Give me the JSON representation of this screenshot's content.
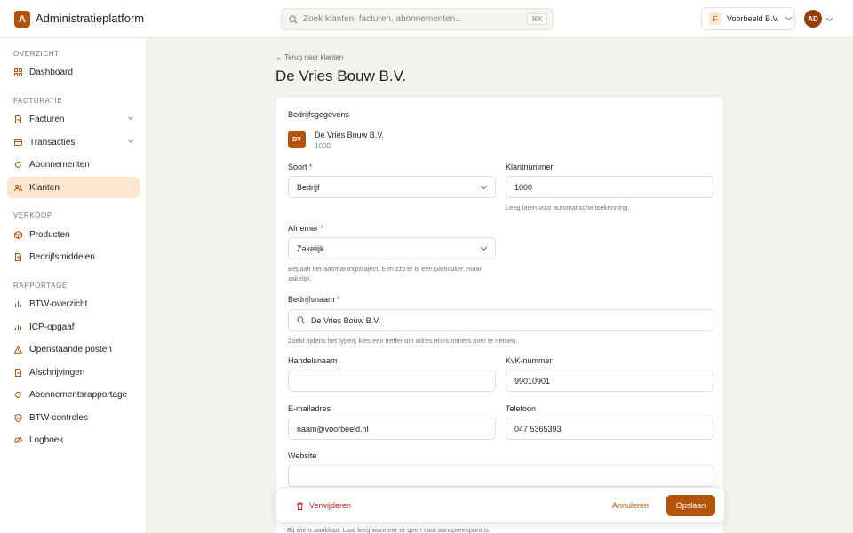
{
  "app": {
    "logo_letter": "A",
    "title": "Administratieplatform"
  },
  "search": {
    "placeholder": "Zoek klanten, facturen, abonnementen...",
    "shortcut": "⌘K"
  },
  "org": {
    "badge": "F",
    "name": "Voorbeeld B.V."
  },
  "user": {
    "initials": "AD"
  },
  "sidebar": {
    "sections": [
      {
        "label": "OVERZICHT",
        "items": [
          {
            "label": "Dashboard",
            "icon": "grid-icon"
          }
        ]
      },
      {
        "label": "FACTURATIE",
        "items": [
          {
            "label": "Facturen",
            "icon": "document-icon",
            "expandable": true
          },
          {
            "label": "Transacties",
            "icon": "card-icon",
            "expandable": true
          },
          {
            "label": "Abonnementen",
            "icon": "refresh-icon"
          },
          {
            "label": "Klanten",
            "icon": "users-icon",
            "active": true
          }
        ]
      },
      {
        "label": "VERKOOP",
        "items": [
          {
            "label": "Producten",
            "icon": "box-icon"
          },
          {
            "label": "Bedrijfsmiddelen",
            "icon": "file-icon"
          }
        ]
      },
      {
        "label": "RAPPORTAGE",
        "items": [
          {
            "label": "BTW-overzicht",
            "icon": "bar-chart-icon"
          },
          {
            "label": "ICP-opgaaf",
            "icon": "bar-chart-icon"
          },
          {
            "label": "Openstaande posten",
            "icon": "warning-icon"
          },
          {
            "label": "Afschrijvingen",
            "icon": "document-icon"
          },
          {
            "label": "Abonnementsrapportage",
            "icon": "refresh-icon"
          },
          {
            "label": "BTW-controles",
            "icon": "shield-icon"
          },
          {
            "label": "Logboek",
            "icon": "eye-off-icon"
          }
        ]
      }
    ]
  },
  "page": {
    "back_label": "← Terug naar klanten",
    "title": "De Vries Bouw B.V."
  },
  "card": {
    "title": "Bedrijfsgegevens",
    "company_initials": "DV",
    "company_name": "De Vries Bouw B.V.",
    "company_number": "1000",
    "soort": {
      "label": "Soort",
      "value": "Bedrijf"
    },
    "klantnummer": {
      "label": "Klantnummer",
      "value": "1000",
      "hint": "Leeg laten voor automatische toekenning."
    },
    "afnemer": {
      "label": "Afnemer",
      "value": "Zakelijk",
      "hint": "Bepaalt het aanmaningstraject. Een zzp'er is een particulier, maar zakelijk."
    },
    "bedrijfsnaam": {
      "label": "Bedrijfsnaam",
      "value": "De Vries Bouw B.V.",
      "hint": "Zoekt tijdens het typen; kies een treffer om adres en nummers over te nemen."
    },
    "handelsnaam": {
      "label": "Handelsnaam",
      "value": ""
    },
    "kvk": {
      "label": "KvK-nummer",
      "value": "99010901"
    },
    "email": {
      "label": "E-mailadres",
      "value": "naam@voorbeeld.nl"
    },
    "telefoon": {
      "label": "Telefoon",
      "value": "047 5365393"
    },
    "website": {
      "label": "Website",
      "value": ""
    },
    "website_hint": "Bij wie u aanklopt. Laat leeg wanneer er geen vast aanspreekpunt is."
  },
  "actions": {
    "delete": "Verwijderen",
    "cancel": "Annuleren",
    "save": "Opslaan"
  },
  "colors": {
    "accent": "#b45309",
    "active_bg": "#fde6cf",
    "danger": "#b91c1c"
  }
}
